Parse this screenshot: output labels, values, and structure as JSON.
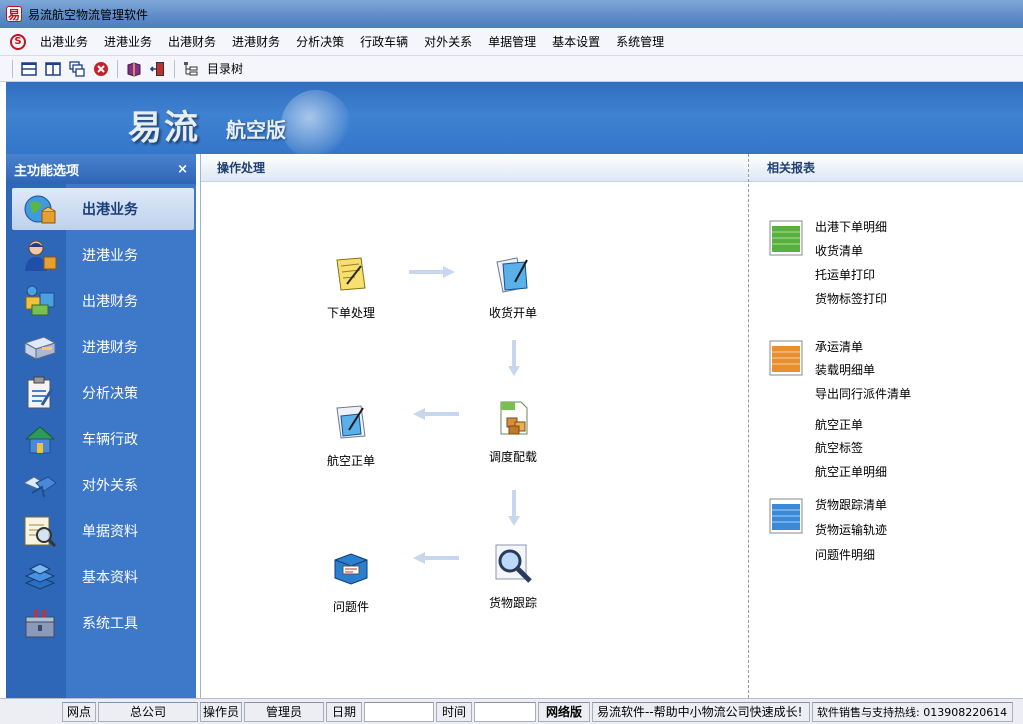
{
  "window": {
    "title": "易流航空物流管理软件",
    "app_icon_glyph": "易"
  },
  "menubar": {
    "items": [
      "出港业务",
      "进港业务",
      "出港财务",
      "进港财务",
      "分析决策",
      "行政车辆",
      "对外关系",
      "单据管理",
      "基本设置",
      "系统管理"
    ]
  },
  "toolbar": {
    "directory_tree_label": "目录树"
  },
  "banner": {
    "title": "易流",
    "subtitle": "航空版"
  },
  "left_panel": {
    "header": "主功能选项",
    "close_glyph": "×",
    "items": [
      "出港业务",
      "进港业务",
      "出港财务",
      "进港财务",
      "分析决策",
      "车辆行政",
      "对外关系",
      "单据资料",
      "基本资料",
      "系统工具"
    ],
    "active_index": 0
  },
  "center": {
    "header": "操作处理",
    "nodes": {
      "order": "下单处理",
      "receive": "收货开单",
      "dispatch": "调度配载",
      "air_waybill": "航空正单",
      "tracking": "货物跟踪",
      "problem": "问题件"
    }
  },
  "right": {
    "header": "相关报表",
    "group1": [
      "出港下单明细",
      "收货清单",
      "托运单打印",
      "货物标签打印"
    ],
    "group2": [
      "承运清单",
      "装载明细单",
      "导出同行派件清单"
    ],
    "group3": [
      "航空正单",
      "航空标签",
      "航空正单明细"
    ],
    "group4": [
      "货物跟踪清单",
      "货物运输轨迹",
      "问题件明细"
    ]
  },
  "statusbar": {
    "outlet_label": "网点",
    "outlet_value": "总公司",
    "operator_label": "操作员",
    "operator_value": "管理员",
    "date_label": "日期",
    "date_value": "",
    "time_label": "时间",
    "time_value": "",
    "edition": "网络版",
    "slogan": "易流软件--帮助中小物流公司快速成长!",
    "hotline": "软件销售与支持热线: 013908220614"
  },
  "colors": {
    "accent": "#3b74c4",
    "banner": "#3476c9",
    "active_item": "#bed1ee"
  }
}
